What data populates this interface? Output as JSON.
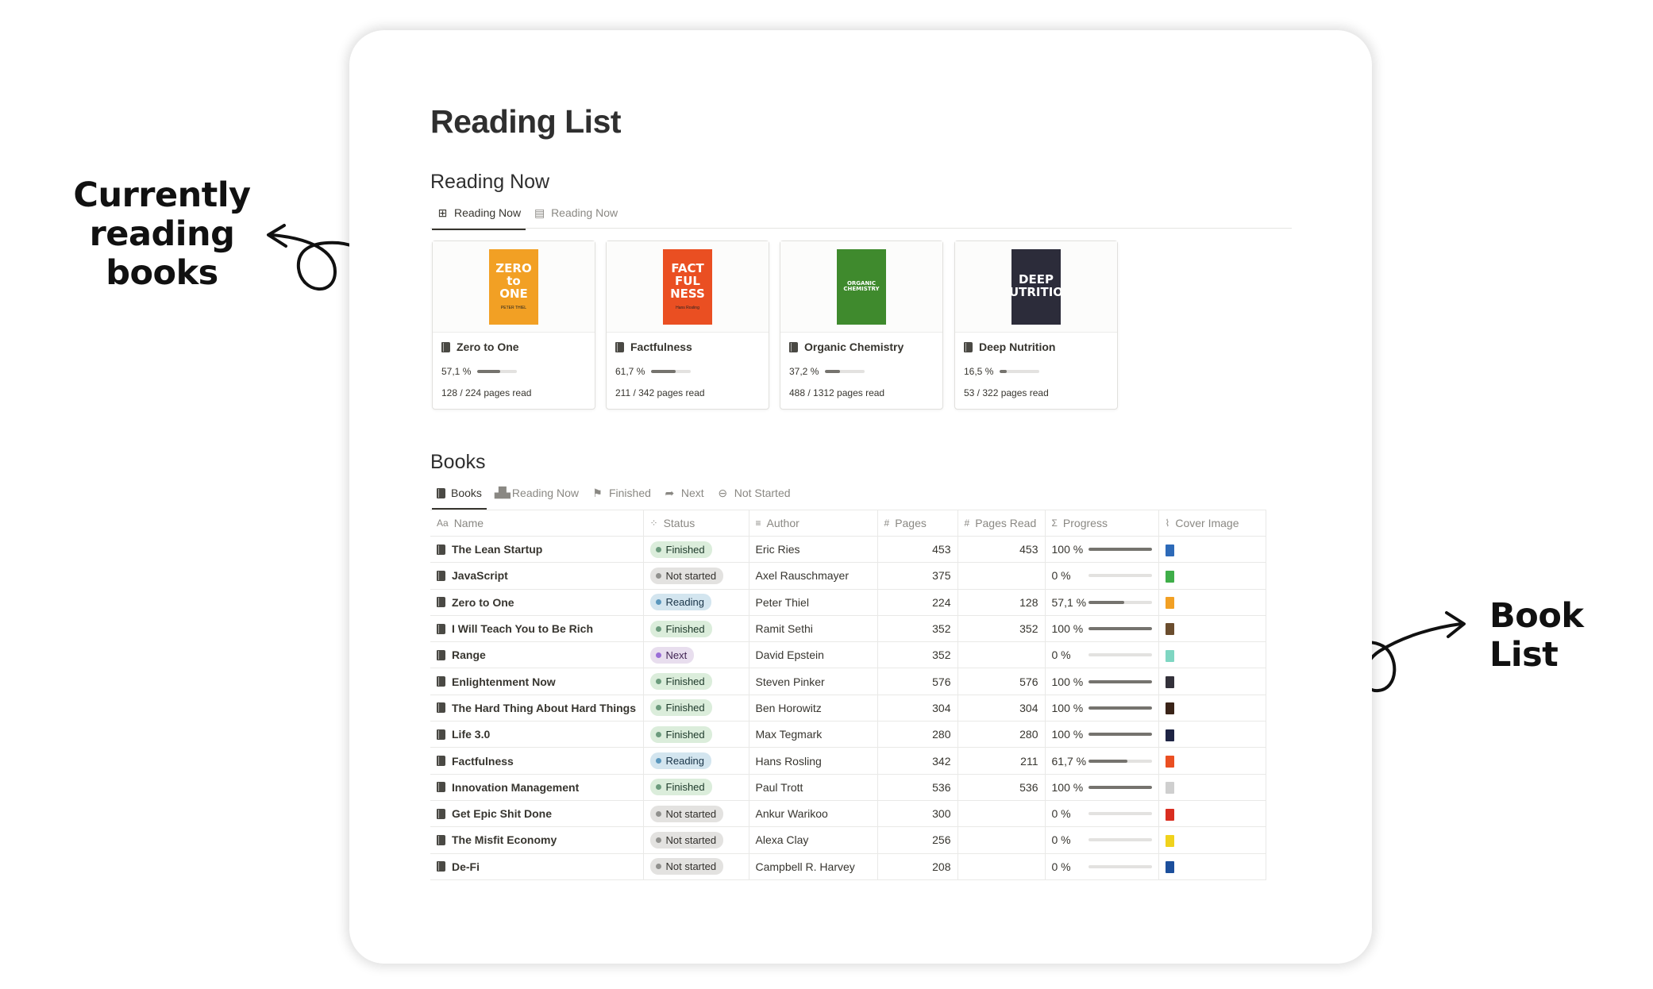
{
  "annotations": {
    "currently_reading": "Currently reading books",
    "currently_reading_line1": "Currently reading",
    "currently_reading_line2": "books",
    "book_list": "Book List"
  },
  "page_title": "Reading List",
  "reading_now": {
    "section_title": "Reading Now",
    "tabs": [
      {
        "label": "Reading Now",
        "icon": "gallery-icon",
        "active": true
      },
      {
        "label": "Reading Now",
        "icon": "table-icon",
        "active": false
      }
    ],
    "cards": [
      {
        "title": "Zero to One",
        "progress_label": "57,1 %",
        "progress": 0.571,
        "pages_label": "128 / 224 pages read",
        "cover_color": "#f2a024",
        "cover_text": [
          "ZERO",
          "to",
          "ONE"
        ],
        "cover_sub": "PETER THIEL"
      },
      {
        "title": "Factfulness",
        "progress_label": "61,7 %",
        "progress": 0.617,
        "pages_label": "211 / 342 pages read",
        "cover_color": "#ea4f22",
        "cover_text": [
          "FACT",
          "FUL",
          "NESS"
        ],
        "cover_sub": "Hans Rosling"
      },
      {
        "title": "Organic Chemistry",
        "progress_label": "37,2 %",
        "progress": 0.372,
        "pages_label": "488 / 1312 pages read",
        "cover_color": "#3f8a2d",
        "cover_text": [
          "ORGANIC CHEMISTRY"
        ],
        "cover_sub": ""
      },
      {
        "title": "Deep Nutrition",
        "progress_label": "16,5 %",
        "progress": 0.165,
        "pages_label": "53 / 322 pages read",
        "cover_color": "#2c2c3a",
        "cover_text": [
          "DEEP",
          "NUTRITION"
        ],
        "cover_sub": ""
      }
    ]
  },
  "books": {
    "section_title": "Books",
    "tabs": [
      {
        "label": "Books",
        "icon": "book-icon",
        "active": true
      },
      {
        "label": "Reading Now",
        "icon": "open-book-icon",
        "active": false
      },
      {
        "label": "Finished",
        "icon": "finish-flag-icon",
        "active": false
      },
      {
        "label": "Next",
        "icon": "forward-arrow-icon",
        "active": false
      },
      {
        "label": "Not Started",
        "icon": "minus-circle-icon",
        "active": false
      }
    ],
    "columns": [
      {
        "label": "Name",
        "icon": "Aa"
      },
      {
        "label": "Status",
        "icon": "⁘"
      },
      {
        "label": "Author",
        "icon": "≡"
      },
      {
        "label": "Pages",
        "icon": "#"
      },
      {
        "label": "Pages Read",
        "icon": "#"
      },
      {
        "label": "Progress",
        "icon": "Σ"
      },
      {
        "label": "Cover Image",
        "icon": "⌇"
      }
    ],
    "status_styles": {
      "Finished": {
        "bg": "#dbeddb",
        "dot": "#6c9b7d",
        "text": "#1c3829"
      },
      "Not started": {
        "bg": "#e3e2e0",
        "dot": "#91918e",
        "text": "#32302c"
      },
      "Reading": {
        "bg": "#d3e5ef",
        "dot": "#5b97bd",
        "text": "#183347"
      },
      "Next": {
        "bg": "#e8deee",
        "dot": "#9a6dd7",
        "text": "#412454"
      }
    },
    "rows": [
      {
        "name": "The Lean Startup",
        "status": "Finished",
        "author": "Eric Ries",
        "pages": "453",
        "pages_read": "453",
        "progress_label": "100 %",
        "progress": 1.0,
        "cover_color": "#2d6ab8"
      },
      {
        "name": "JavaScript",
        "status": "Not started",
        "author": "Axel Rauschmayer",
        "pages": "375",
        "pages_read": "",
        "progress_label": "0 %",
        "progress": 0,
        "cover_color": "#3fae49"
      },
      {
        "name": "Zero to One",
        "status": "Reading",
        "author": "Peter Thiel",
        "pages": "224",
        "pages_read": "128",
        "progress_label": "57,1 %",
        "progress": 0.571,
        "cover_color": "#f2a024"
      },
      {
        "name": "I Will Teach You to Be Rich",
        "status": "Finished",
        "author": "Ramit Sethi",
        "pages": "352",
        "pages_read": "352",
        "progress_label": "100 %",
        "progress": 1.0,
        "cover_color": "#6b4d2e"
      },
      {
        "name": "Range",
        "status": "Next",
        "author": "David Epstein",
        "pages": "352",
        "pages_read": "",
        "progress_label": "0 %",
        "progress": 0,
        "cover_color": "#7fd6c2"
      },
      {
        "name": "Enlightenment Now",
        "status": "Finished",
        "author": "Steven Pinker",
        "pages": "576",
        "pages_read": "576",
        "progress_label": "100 %",
        "progress": 1.0,
        "cover_color": "#33313a"
      },
      {
        "name": "The Hard Thing About Hard Things",
        "status": "Finished",
        "author": "Ben Horowitz",
        "pages": "304",
        "pages_read": "304",
        "progress_label": "100 %",
        "progress": 1.0,
        "cover_color": "#3a2418"
      },
      {
        "name": "Life 3.0",
        "status": "Finished",
        "author": "Max Tegmark",
        "pages": "280",
        "pages_read": "280",
        "progress_label": "100 %",
        "progress": 1.0,
        "cover_color": "#1e2444"
      },
      {
        "name": "Factfulness",
        "status": "Reading",
        "author": "Hans Rosling",
        "pages": "342",
        "pages_read": "211",
        "progress_label": "61,7 %",
        "progress": 0.617,
        "cover_color": "#ea4f22"
      },
      {
        "name": "Innovation Management",
        "status": "Finished",
        "author": "Paul Trott",
        "pages": "536",
        "pages_read": "536",
        "progress_label": "100 %",
        "progress": 1.0,
        "cover_color": "#cfcfcf"
      },
      {
        "name": "Get Epic Shit Done",
        "status": "Not started",
        "author": "Ankur Warikoo",
        "pages": "300",
        "pages_read": "",
        "progress_label": "0 %",
        "progress": 0,
        "cover_color": "#d92d20"
      },
      {
        "name": "The Misfit Economy",
        "status": "Not started",
        "author": "Alexa Clay",
        "pages": "256",
        "pages_read": "",
        "progress_label": "0 %",
        "progress": 0,
        "cover_color": "#f0d21c"
      },
      {
        "name": "De-Fi",
        "status": "Not started",
        "author": "Campbell R. Harvey",
        "pages": "208",
        "pages_read": "",
        "progress_label": "0 %",
        "progress": 0,
        "cover_color": "#1c4f9c"
      }
    ]
  }
}
